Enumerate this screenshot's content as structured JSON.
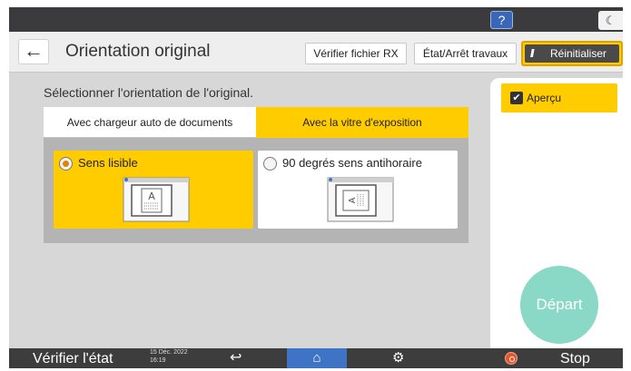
{
  "topbar": {
    "help_label": "?",
    "moon_icon": "moon-icon"
  },
  "header": {
    "back_icon": "back-arrow-icon",
    "title": "Orientation original",
    "verify_rx_label": "Vérifier fichier RX",
    "jobs_label": "État/Arrêt travaux",
    "reset_label": "Réinitialiser",
    "reset_icon": "reset-icon",
    "reset_accent": "#ffcc00"
  },
  "main": {
    "instruction": "Sélectionner l'orientation de l'original.",
    "tabs": [
      {
        "label": "Avec chargeur auto de documents",
        "selected": false
      },
      {
        "label": "Avec la vitre d'exposition",
        "selected": true
      }
    ],
    "options": [
      {
        "label": "Sens lisible",
        "selected": true,
        "icon": "scanner-readable-icon"
      },
      {
        "label": "90 degrés sens antihoraire",
        "selected": false,
        "icon": "scanner-rotated-icon"
      }
    ],
    "selected_color": "#ffcc00"
  },
  "side": {
    "preview_label": "Aperçu",
    "preview_checked": true,
    "start_label": "Départ",
    "start_color": "#8ad8c6"
  },
  "bottombar": {
    "check_state_label": "Vérifier l'état",
    "date": "15 Déc. 2022",
    "time": "16:19",
    "back_icon": "return-icon",
    "home_icon": "home-icon",
    "settings_icon": "gear-icon",
    "stop_icon": "stop-icon",
    "stop_label": "Stop",
    "home_color": "#3f73c6"
  }
}
